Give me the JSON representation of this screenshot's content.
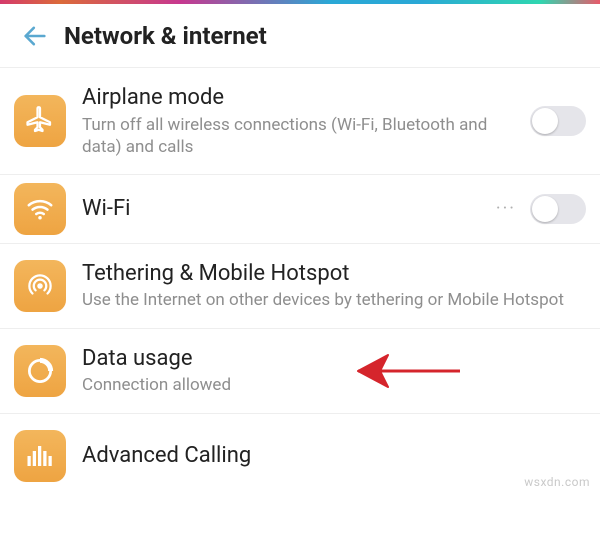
{
  "header": {
    "title": "Network & internet"
  },
  "items": {
    "airplane": {
      "title": "Airplane mode",
      "sub": "Turn off all wireless connections (Wi-Fi, Bluetooth and data) and calls"
    },
    "wifi": {
      "title": "Wi-Fi"
    },
    "tethering": {
      "title": "Tethering & Mobile Hotspot",
      "sub": "Use the Internet on other devices by tethering or Mobile Hotspot"
    },
    "data_usage": {
      "title": "Data usage",
      "sub": "Connection allowed"
    },
    "advanced_calling": {
      "title": "Advanced Calling"
    }
  },
  "watermark": "wsxdn.com",
  "colors": {
    "accent_icon_bg": "#efaa4c",
    "back_arrow": "#5aa8d0",
    "annotation_arrow": "#d5252c"
  }
}
